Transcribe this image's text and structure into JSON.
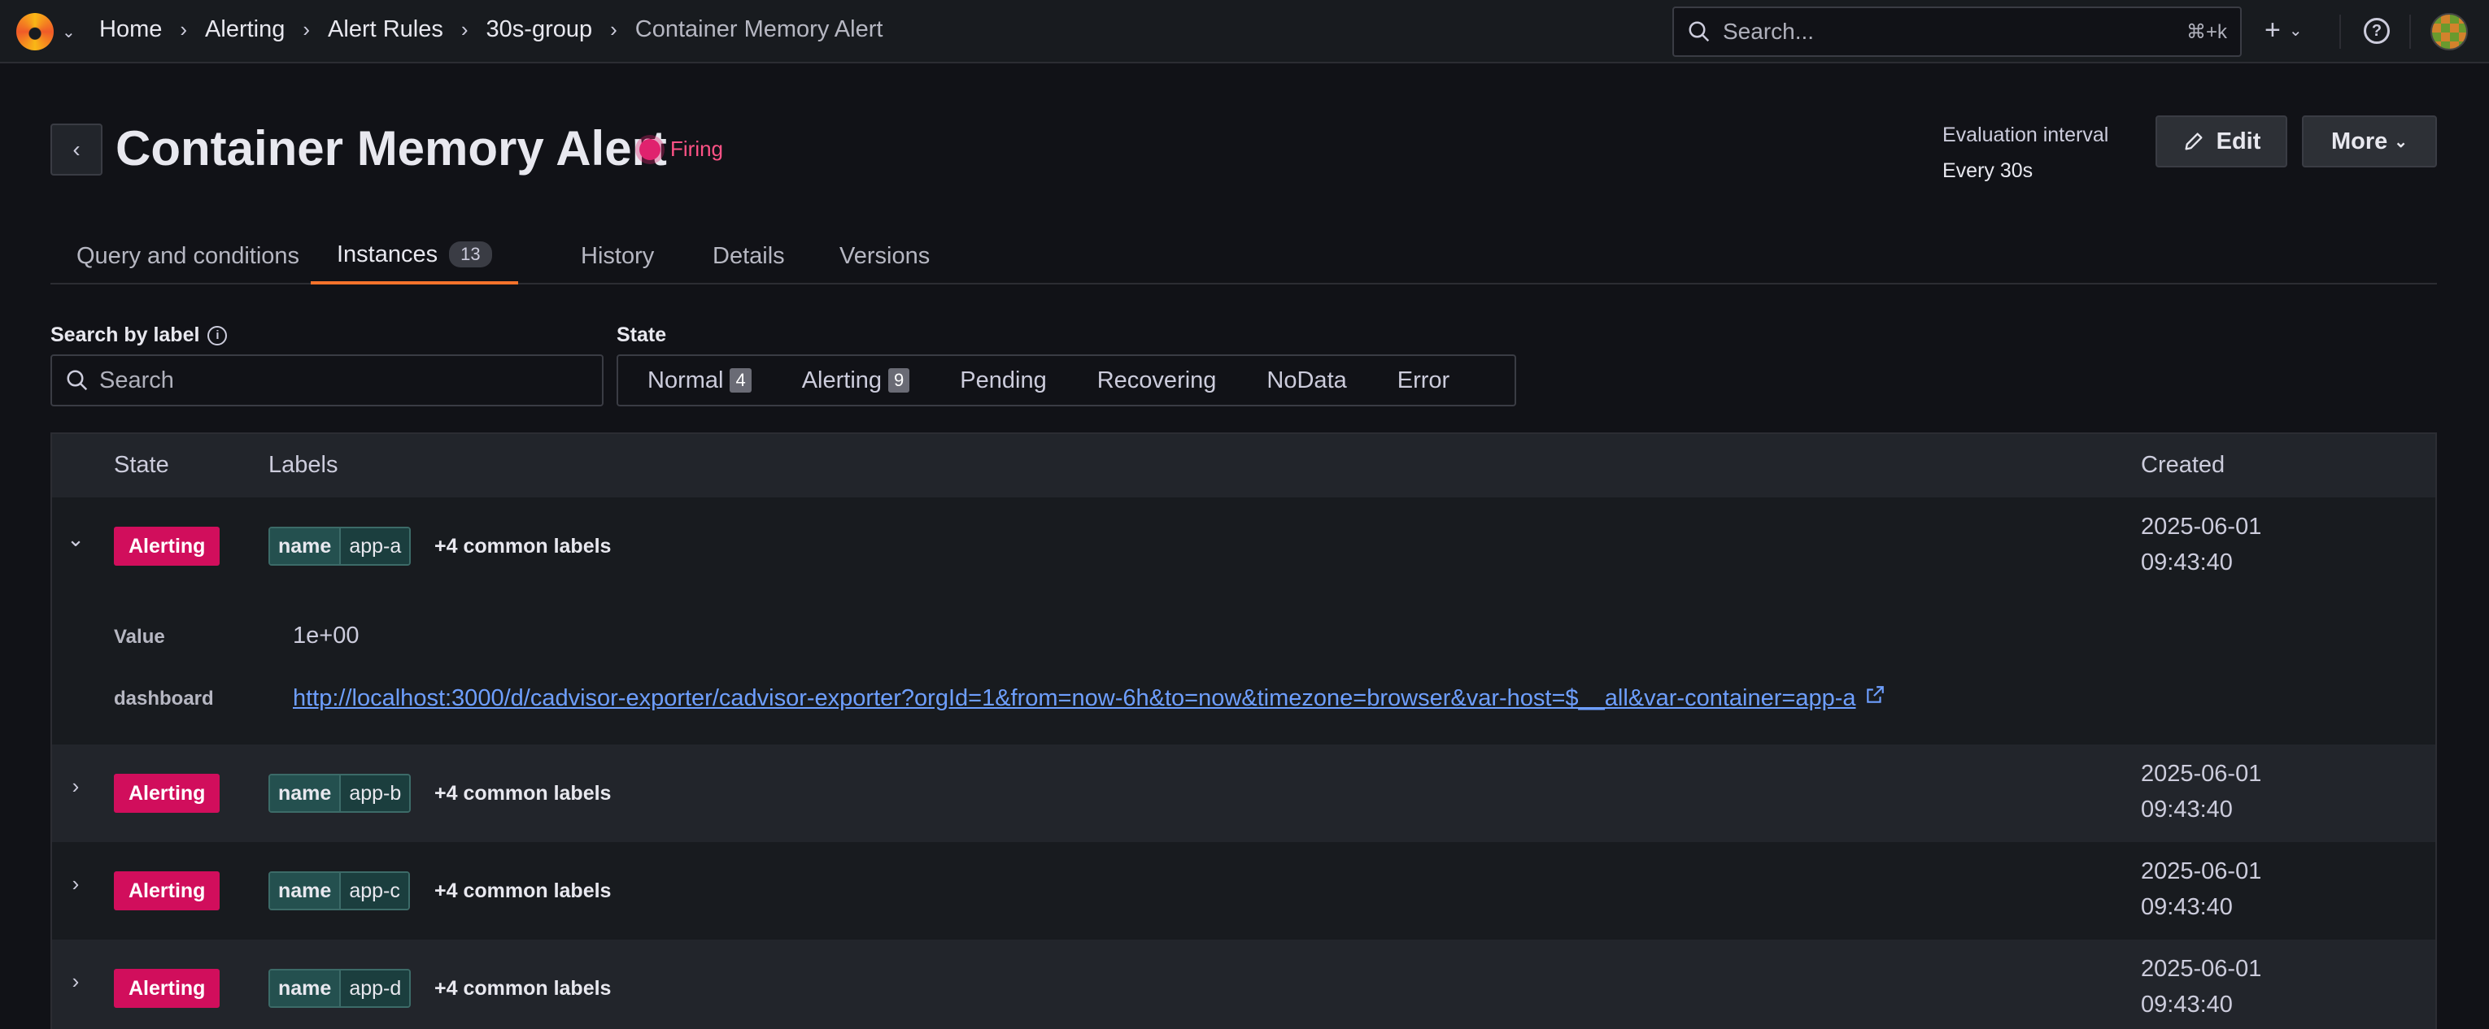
{
  "breadcrumbs": [
    "Home",
    "Alerting",
    "Alert Rules",
    "30s-group",
    "Container Memory Alert"
  ],
  "search": {
    "placeholder": "Search...",
    "shortcut": "⌘+k"
  },
  "header": {
    "title": "Container Memory Alert",
    "status": "Firing",
    "eval_label": "Evaluation interval",
    "eval_value": "Every 30s",
    "edit_label": "Edit",
    "more_label": "More"
  },
  "tabs": [
    {
      "label": "Query and conditions"
    },
    {
      "label": "Instances",
      "count": "13"
    },
    {
      "label": "History"
    },
    {
      "label": "Details"
    },
    {
      "label": "Versions"
    }
  ],
  "filters": {
    "label_search_title": "Search by label",
    "label_search_placeholder": "Search",
    "state_title": "State",
    "states": [
      {
        "label": "Normal",
        "count": "4"
      },
      {
        "label": "Alerting",
        "count": "9"
      },
      {
        "label": "Pending"
      },
      {
        "label": "Recovering"
      },
      {
        "label": "NoData"
      },
      {
        "label": "Error"
      }
    ]
  },
  "table": {
    "columns": [
      "State",
      "Labels",
      "Created"
    ],
    "rows": [
      {
        "state": "Alerting",
        "label_key": "name",
        "label_value": "app-a",
        "common": "+4 common labels",
        "created_date": "2025-06-01",
        "created_time": "09:43:40"
      },
      {
        "state": "Alerting",
        "label_key": "name",
        "label_value": "app-b",
        "common": "+4 common labels",
        "created_date": "2025-06-01",
        "created_time": "09:43:40"
      },
      {
        "state": "Alerting",
        "label_key": "name",
        "label_value": "app-c",
        "common": "+4 common labels",
        "created_date": "2025-06-01",
        "created_time": "09:43:40"
      },
      {
        "state": "Alerting",
        "label_key": "name",
        "label_value": "app-d",
        "common": "+4 common labels",
        "created_date": "2025-06-01",
        "created_time": "09:43:40"
      }
    ],
    "expanded": {
      "value_label": "Value",
      "value": "1e+00",
      "dashboard_label": "dashboard",
      "dashboard_url": "http://localhost:3000/d/cadvisor-exporter/cadvisor-exporter?orgId=1&from=now-6h&to=now&timezone=browser&var-host=$__all&var-container=app-a"
    }
  },
  "colors": {
    "accent": "#f5722b",
    "alerting": "#d10e5c",
    "firing": "#ff5286",
    "link": "#6e9fff"
  }
}
